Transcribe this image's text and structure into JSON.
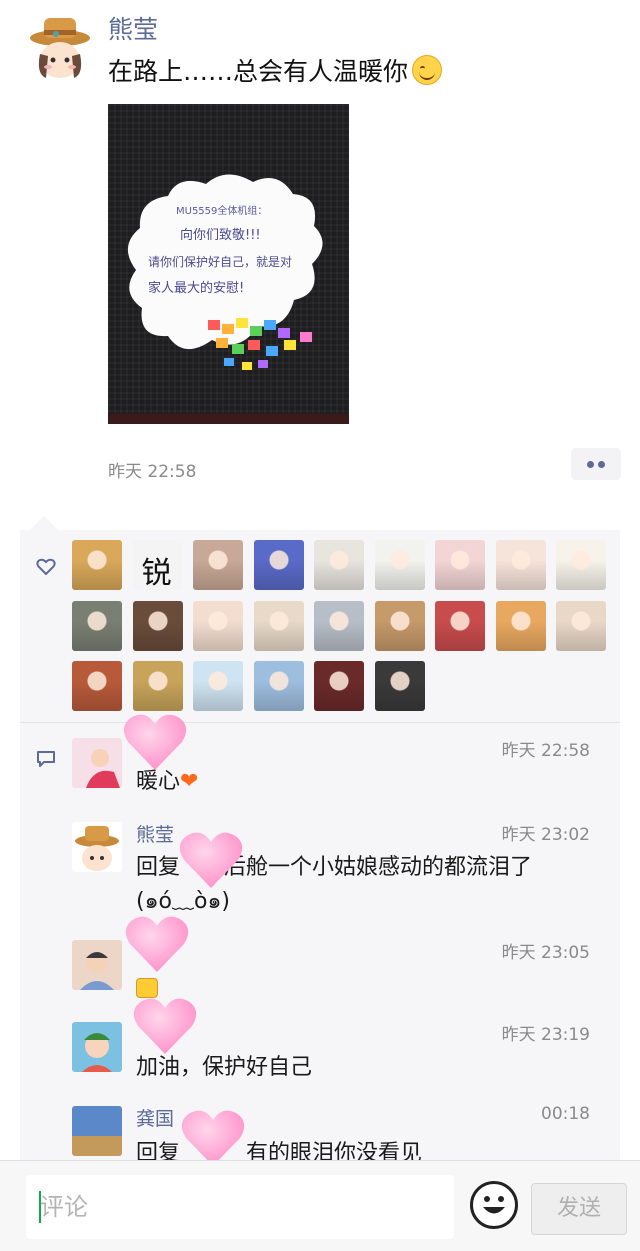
{
  "post": {
    "author": "熊莹",
    "text": "在路上……总会有人温暖你",
    "photo_note_lines": [
      "MU5559全体机组：",
      "向你们致敬!!!",
      "请你们保护好自己，就是对",
      "家人最大的安慰!"
    ],
    "timestamp": "昨天 22:58"
  },
  "likes": {
    "icon": "heart-outline-icon",
    "avatars": [
      {
        "color": "#d9a85a"
      },
      {
        "color": "#f4f4f4",
        "glyph": "锐"
      },
      {
        "color": "#c8a896"
      },
      {
        "color": "#5a6ac8"
      },
      {
        "color": "#e8e4de"
      },
      {
        "color": "#f2f2ee"
      },
      {
        "color": "#f3d5d5"
      },
      {
        "color": "#f6e4da"
      },
      {
        "color": "#f7f3ea"
      },
      {
        "color": "#7a7f73"
      },
      {
        "color": "#6a4c3b"
      },
      {
        "color": "#f3ddd0"
      },
      {
        "color": "#e8d9c9"
      },
      {
        "color": "#b8bec8"
      },
      {
        "color": "#c69a6a"
      },
      {
        "color": "#c94c4c"
      },
      {
        "color": "#e9a860"
      },
      {
        "color": "#e9d8c8"
      },
      {
        "color": "#b85a3a"
      },
      {
        "color": "#c8a45a"
      },
      {
        "color": "#cfe4f2"
      },
      {
        "color": "#9ebee0"
      },
      {
        "color": "#6b2a2a"
      },
      {
        "color": "#3a3a3a"
      }
    ]
  },
  "comments": [
    {
      "name": "",
      "time": "昨天 22:58",
      "text": "暖心",
      "avatar_color": "#f4d5dc"
    },
    {
      "name": "熊莹",
      "time": "昨天 23:02",
      "text": "回复",
      "text_line1": "后舱一个小姑娘感动的都流泪了",
      "text_line2": "(๑ó﹏ò๑)",
      "avatar_color": "#d9a85a"
    },
    {
      "name": "",
      "time": "昨天 23:05",
      "text": "",
      "avatar_color": "#e6d0c2"
    },
    {
      "name": "",
      "time": "昨天 23:19",
      "text": "加油，保护好自己",
      "avatar_color": "#6bb2d6"
    },
    {
      "name": "龚国",
      "time": "00:18",
      "text": "回复",
      "text_tail": "有的眼泪你没看见",
      "avatar_color": "#5b88c8"
    }
  ],
  "input": {
    "placeholder": "评论"
  },
  "send_label": "发送",
  "colors": {
    "name": "#5b6b95",
    "background": "#f6f6f8"
  }
}
